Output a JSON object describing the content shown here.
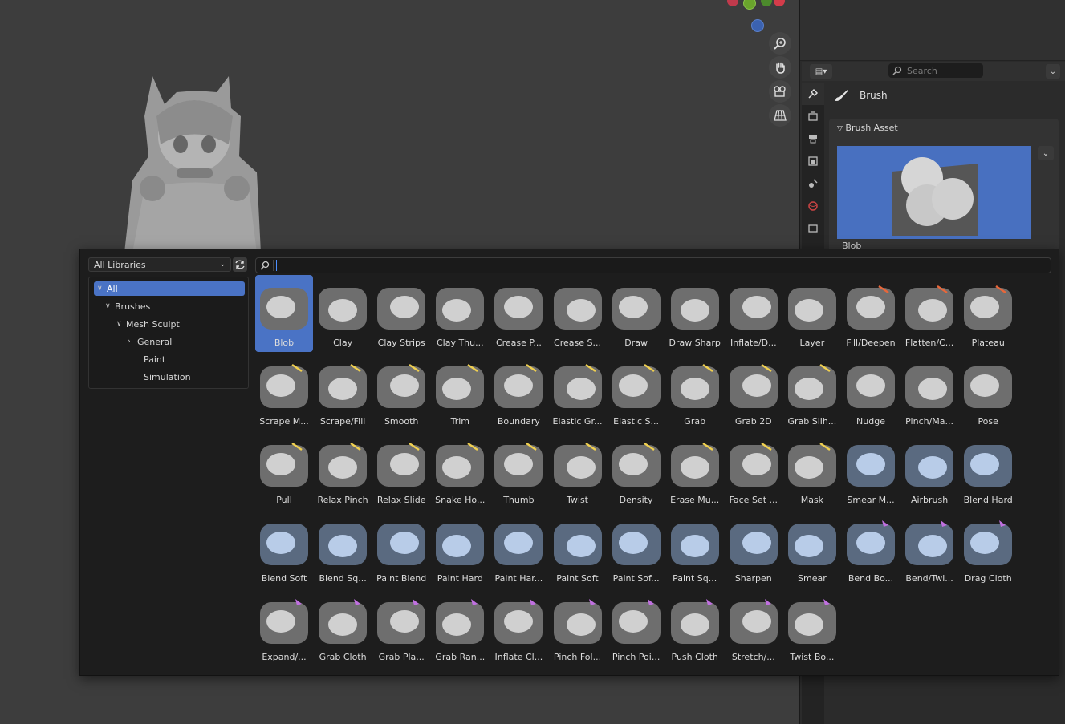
{
  "properties": {
    "search_placeholder": "Search",
    "brush_title": "Brush",
    "asset_panel_title": "Brush Asset",
    "asset_preview_label": "Blob"
  },
  "browser": {
    "library_selected": "All Libraries",
    "search_value": "",
    "tree": [
      {
        "label": "All",
        "level": 0,
        "expanded": true,
        "selected": true
      },
      {
        "label": "Brushes",
        "level": 1,
        "expanded": true
      },
      {
        "label": "Mesh Sculpt",
        "level": 2,
        "expanded": true
      },
      {
        "label": "General",
        "level": 3,
        "expanded": false
      },
      {
        "label": "Paint",
        "level": 3
      },
      {
        "label": "Simulation",
        "level": 3
      }
    ],
    "brushes": [
      [
        "Blob",
        "Clay",
        "Clay Strips",
        "Clay Thu...",
        "Crease P...",
        "Crease S...",
        "Draw",
        "Draw Sharp",
        "Inflate/D...",
        "Layer",
        "Fill/Deepen",
        "Flatten/C...",
        "Plateau"
      ],
      [
        "Scrape M...",
        "Scrape/Fill",
        "Smooth",
        "Trim",
        "Boundary",
        "Elastic Gr...",
        "Elastic S...",
        "Grab",
        "Grab 2D",
        "Grab Silh...",
        "Nudge",
        "Pinch/Ma...",
        "Pose"
      ],
      [
        "Pull",
        "Relax Pinch",
        "Relax Slide",
        "Snake Ho...",
        "Thumb",
        "Twist",
        "Density",
        "Erase Mu...",
        "Face Set ...",
        "Mask",
        "Smear M...",
        "Airbrush",
        "Blend Hard"
      ],
      [
        "Blend Soft",
        "Blend Sq...",
        "Paint Blend",
        "Paint Hard",
        "Paint Har...",
        "Paint Soft",
        "Paint Sof...",
        "Paint Sq...",
        "Sharpen",
        "Smear",
        "Bend Bo...",
        "Bend/Twi...",
        "Drag Cloth"
      ],
      [
        "Expand/...",
        "Grab Cloth",
        "Grab Pla...",
        "Grab Ran...",
        "Inflate Cl...",
        "Pinch Fol...",
        "Pinch Poi...",
        "Push Cloth",
        "Stretch/...",
        "Twist Bo..."
      ]
    ],
    "selected_brush": "Blob"
  },
  "icons": [
    "zoom-icon",
    "hand-icon",
    "camera-icon",
    "grid-icon",
    "tool-icon",
    "render-icon",
    "output-icon",
    "view-layer-icon",
    "scene-icon",
    "world-icon",
    "collection-icon",
    "brush-icon",
    "refresh-icon",
    "search-icon"
  ],
  "colors": {
    "accent": "#4a73c5",
    "panel": "#1d1d1d",
    "viewport": "#3d3d3d"
  }
}
